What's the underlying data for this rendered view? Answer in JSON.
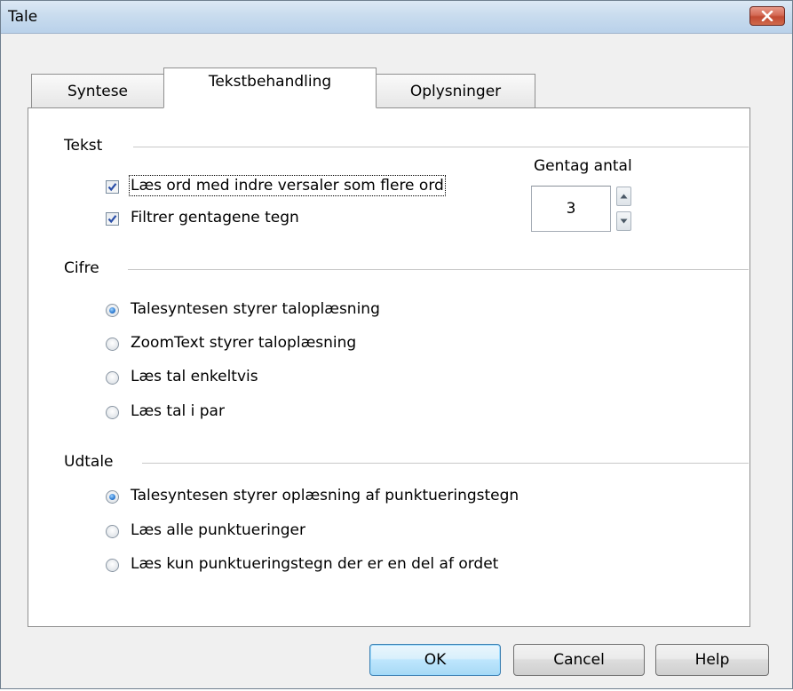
{
  "window": {
    "title": "Tale"
  },
  "tabs": [
    {
      "label": "Syntese",
      "active": false
    },
    {
      "label": "Tekstbehandling",
      "active": true
    },
    {
      "label": "Oplysninger",
      "active": false
    }
  ],
  "tekst": {
    "heading": "Tekst",
    "checkboxes": [
      {
        "label": "Læs ord med indre versaler som flere ord",
        "checked": true
      },
      {
        "label": "Filtrer gentagene tegn",
        "checked": true
      }
    ],
    "repeat_label": "Gentag antal",
    "repeat_value": "3"
  },
  "cifre": {
    "heading": "Cifre",
    "options": [
      {
        "label": "Talesyntesen styrer taloplæsning",
        "selected": true
      },
      {
        "label": "ZoomText styrer taloplæsning",
        "selected": false
      },
      {
        "label": "Læs tal enkeltvis",
        "selected": false
      },
      {
        "label": "Læs tal i par",
        "selected": false
      }
    ]
  },
  "udtale": {
    "heading": "Udtale",
    "options": [
      {
        "label": "Talesyntesen styrer oplæsning af punktueringstegn",
        "selected": true
      },
      {
        "label": "Læs alle punktueringer",
        "selected": false
      },
      {
        "label": "Læs kun punktueringstegn der er en del af ordet",
        "selected": false
      }
    ]
  },
  "buttons": {
    "ok": "OK",
    "cancel": "Cancel",
    "help": "Help"
  },
  "colors": {
    "selection_accent": "#2e7bd1",
    "close_button": "#c24a33"
  },
  "icons": [
    "close-icon",
    "checkmark-icon",
    "spin-up-icon",
    "spin-down-icon"
  ]
}
